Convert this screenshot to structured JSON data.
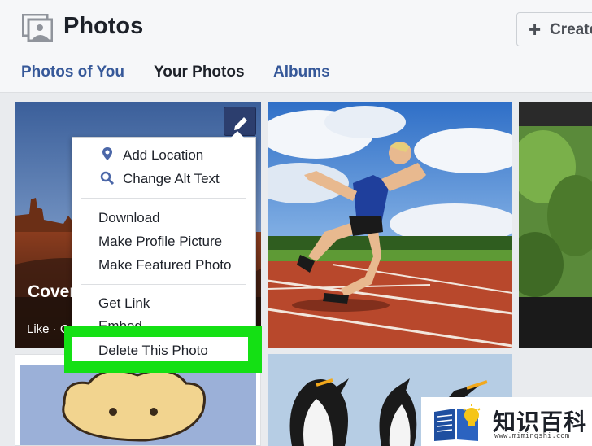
{
  "header": {
    "title": "Photos",
    "create_label": "Create",
    "create_icon": "plus-icon"
  },
  "tabs": [
    {
      "label": "Photos of You"
    },
    {
      "label": "Your Photos"
    },
    {
      "label": "Albums"
    }
  ],
  "cover_tile": {
    "title": "Cover",
    "meta": "Like · C"
  },
  "menu": {
    "items": [
      {
        "label": "Add Location",
        "icon": "location-pin-icon"
      },
      {
        "label": "Change Alt Text",
        "icon": "search-icon"
      },
      {
        "label": "Download"
      },
      {
        "label": "Make Profile Picture"
      },
      {
        "label": "Make Featured Photo"
      },
      {
        "label": "Get Link"
      },
      {
        "label": "Embed"
      },
      {
        "label": "Delete This Photo"
      }
    ]
  },
  "watermark": {
    "text": "知识百科",
    "url": "www.mimingshi.com"
  },
  "colors": {
    "link": "#365899",
    "highlight": "#14e014",
    "edit_button": "#2c3e6e"
  }
}
